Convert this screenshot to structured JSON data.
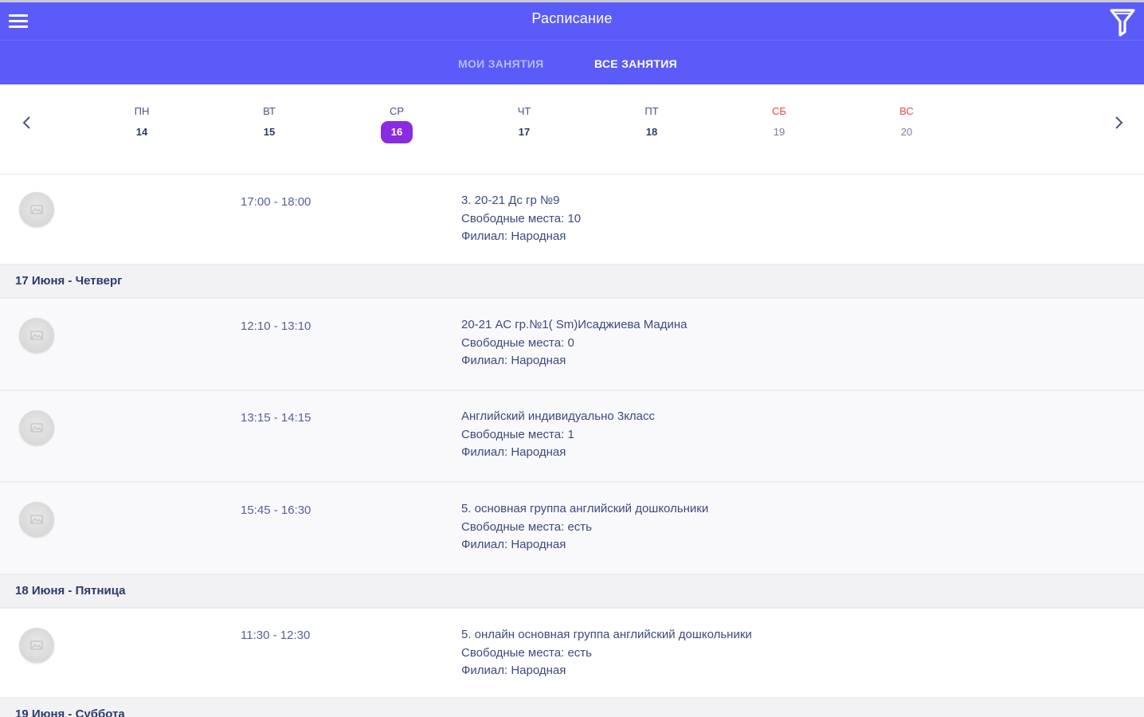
{
  "appbar": {
    "title": "Расписание",
    "colors": {
      "primary": "#5b5bfa",
      "selected_day": "#8a2be2",
      "weekend": "#e54848"
    },
    "menu_icon": "hamburger-menu-icon",
    "filter_icon": "filter-funnel-icon"
  },
  "tabs": [
    {
      "label": "МОИ ЗАНЯТИЯ",
      "active": false
    },
    {
      "label": "ВСЕ ЗАНЯТИЯ",
      "active": true
    }
  ],
  "week": {
    "prev_icon": "chevron-left-icon",
    "next_icon": "chevron-right-icon",
    "days": [
      {
        "name": "ПН",
        "num": "14"
      },
      {
        "name": "ВТ",
        "num": "15"
      },
      {
        "name": "СР",
        "num": "16",
        "selected": true
      },
      {
        "name": "ЧТ",
        "num": "17"
      },
      {
        "name": "ПТ",
        "num": "18"
      },
      {
        "name": "СБ",
        "num": "19",
        "weekend": true
      },
      {
        "name": "ВС",
        "num": "20",
        "weekend": true
      }
    ]
  },
  "schedule": {
    "item0": {
      "time": "17:00 - 18:00",
      "name": "3. 20-21 Дс гр №9",
      "seats": "Свободные места: 10",
      "branch": "Филиал: Народная"
    },
    "header1": "17 Июня - Четверг",
    "item1": {
      "time": "12:10 - 13:10",
      "name": "20-21 АС гр.№1( Sm)Исаджиева Мадина",
      "seats": "Свободные места: 0",
      "branch": "Филиал: Народная"
    },
    "item2": {
      "time": "13:15 - 14:15",
      "name": "Английский индивидуально 3класс",
      "seats": "Свободные места: 1",
      "branch": "Филиал: Народная"
    },
    "item3": {
      "time": "15:45 - 16:30",
      "name": "5. основная группа английский дошкольники",
      "seats": "Свободные места: есть",
      "branch": "Филиал: Народная"
    },
    "header2": "18 Июня - Пятница",
    "item4": {
      "time": "11:30 - 12:30",
      "name": "5. онлайн основная группа английский дошкольники",
      "seats": "Свободные места: есть",
      "branch": "Филиал: Народная"
    },
    "header3": "19 Июня - Суббота"
  }
}
